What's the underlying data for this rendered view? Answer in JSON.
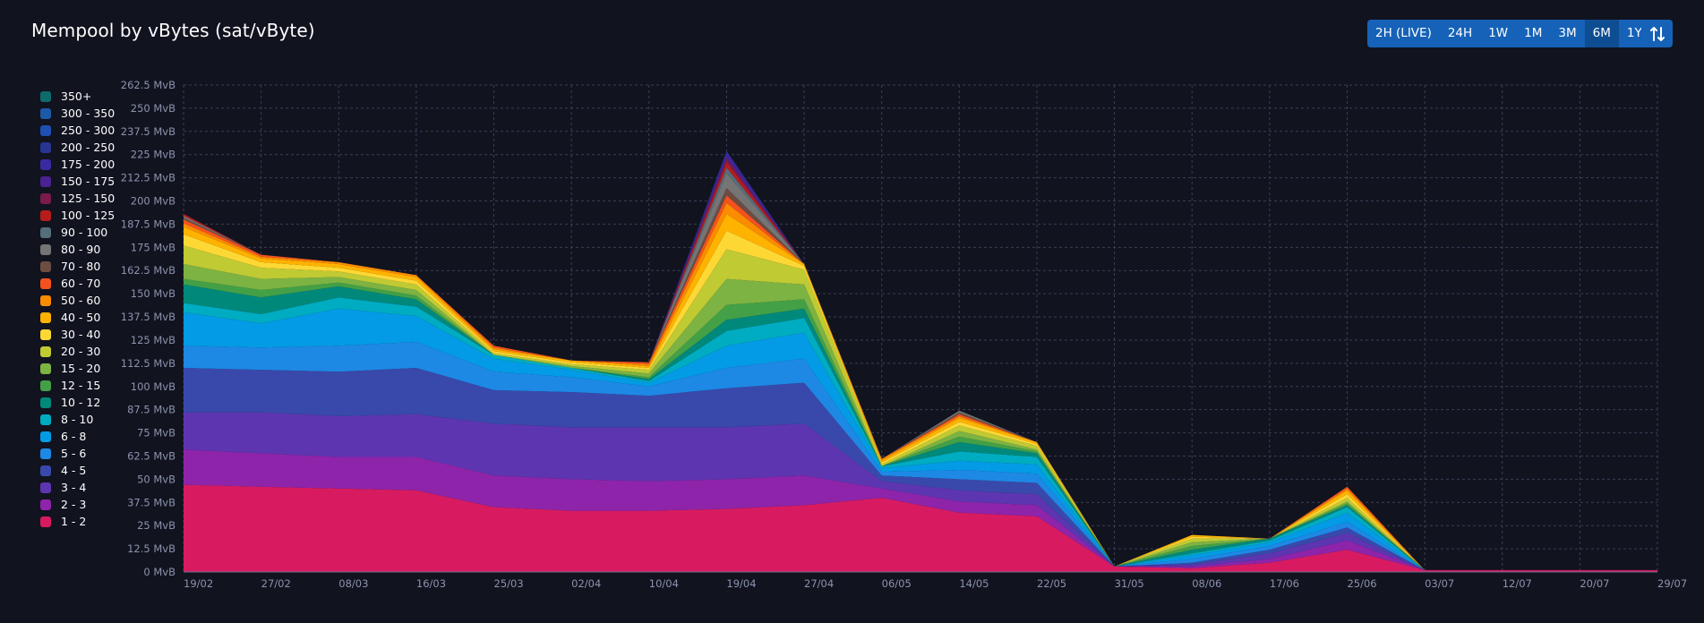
{
  "page": {
    "title": "Mempool by vBytes (sat/vByte)"
  },
  "range_buttons": [
    "2H (LIVE)",
    "24H",
    "1W",
    "1M",
    "3M",
    "6M",
    "1Y"
  ],
  "active_range": "6M",
  "invert_icon": "swap-vertical-icon",
  "chart_data": {
    "type": "area",
    "stacked": true,
    "title": "Mempool by vBytes (sat/vByte)",
    "ylabel_unit": "MvB",
    "ylim": [
      0,
      262.5
    ],
    "y_ticks": [
      "0 MvB",
      "12.5 MvB",
      "25 MvB",
      "37.5 MvB",
      "50 MvB",
      "62.5 MvB",
      "75 MvB",
      "87.5 MvB",
      "100 MvB",
      "112.5 MvB",
      "125 MvB",
      "137.5 MvB",
      "150 MvB",
      "162.5 MvB",
      "175 MvB",
      "187.5 MvB",
      "200 MvB",
      "212.5 MvB",
      "225 MvB",
      "237.5 MvB",
      "250 MvB",
      "262.5 MvB"
    ],
    "x_ticks": [
      "19/02",
      "27/02",
      "08/03",
      "16/03",
      "25/03",
      "02/04",
      "10/04",
      "19/04",
      "27/04",
      "06/05",
      "14/05",
      "22/05",
      "31/05",
      "08/06",
      "17/06",
      "25/06",
      "03/07",
      "12/07",
      "20/07",
      "29/07"
    ],
    "grid": true,
    "legend_position": "left",
    "legend": [
      {
        "label": "350+",
        "color": "#0e6b6b"
      },
      {
        "label": "300 - 350",
        "color": "#1b5aa6"
      },
      {
        "label": "250 - 300",
        "color": "#1e4fb3"
      },
      {
        "label": "200 - 250",
        "color": "#283593"
      },
      {
        "label": "175 - 200",
        "color": "#3a2aa0"
      },
      {
        "label": "150 - 175",
        "color": "#4a2292"
      },
      {
        "label": "125 - 150",
        "color": "#7b1b4d"
      },
      {
        "label": "100 - 125",
        "color": "#b71c1c"
      },
      {
        "label": "90 - 100",
        "color": "#546e7a"
      },
      {
        "label": "80 - 90",
        "color": "#757575"
      },
      {
        "label": "70 - 80",
        "color": "#6d4c41"
      },
      {
        "label": "60 - 70",
        "color": "#f4511e"
      },
      {
        "label": "50 - 60",
        "color": "#fb8c00"
      },
      {
        "label": "40 - 50",
        "color": "#ffb300"
      },
      {
        "label": "30 - 40",
        "color": "#fdd835"
      },
      {
        "label": "20 - 30",
        "color": "#c0ca33"
      },
      {
        "label": "15 - 20",
        "color": "#7cb342"
      },
      {
        "label": "12 - 15",
        "color": "#43a047"
      },
      {
        "label": "10 - 12",
        "color": "#00897b"
      },
      {
        "label": "8 - 10",
        "color": "#00acc1"
      },
      {
        "label": "6 - 8",
        "color": "#039be5"
      },
      {
        "label": "5 - 6",
        "color": "#1e88e5"
      },
      {
        "label": "4 - 5",
        "color": "#3949ab"
      },
      {
        "label": "3 - 4",
        "color": "#5e35b1"
      },
      {
        "label": "2 - 3",
        "color": "#8e24aa"
      },
      {
        "label": "1 - 2",
        "color": "#d81b60"
      }
    ],
    "x": [
      "19/02",
      "27/02",
      "08/03",
      "16/03",
      "25/03",
      "02/04",
      "10/04",
      "19/04",
      "27/04",
      "06/05",
      "14/05",
      "22/05",
      "31/05",
      "08/06",
      "17/06",
      "25/06",
      "03/07",
      "12/07",
      "20/07",
      "29/07"
    ],
    "series": [
      {
        "name": "1 - 2",
        "values": [
          47,
          46,
          45,
          44,
          35,
          33,
          33,
          34,
          36,
          40,
          32,
          30,
          3,
          2,
          5,
          12,
          1,
          1,
          1,
          1
        ]
      },
      {
        "name": "2 - 3",
        "values": [
          19,
          18,
          17,
          18,
          17,
          17,
          16,
          16,
          16,
          5,
          6,
          6,
          0,
          1,
          2,
          5,
          0,
          0,
          0,
          0
        ]
      },
      {
        "name": "3 - 4",
        "values": [
          20,
          22,
          22,
          23,
          28,
          28,
          29,
          28,
          28,
          4,
          6,
          6,
          0,
          1,
          3,
          4,
          0,
          0,
          0,
          0
        ]
      },
      {
        "name": "4 - 5",
        "values": [
          24,
          23,
          24,
          25,
          18,
          19,
          17,
          21,
          22,
          3,
          6,
          6,
          0,
          1,
          2,
          3,
          0,
          0,
          0,
          0
        ]
      },
      {
        "name": "5 - 6",
        "values": [
          12,
          12,
          14,
          14,
          10,
          8,
          5,
          11,
          13,
          2,
          5,
          5,
          0,
          2,
          2,
          3,
          0,
          0,
          0,
          0
        ]
      },
      {
        "name": "6 - 8",
        "values": [
          18,
          13,
          20,
          14,
          7,
          4,
          2,
          12,
          14,
          2,
          5,
          5,
          0,
          2,
          2,
          5,
          0,
          0,
          0,
          0
        ]
      },
      {
        "name": "8 - 10",
        "values": [
          5,
          5,
          6,
          5,
          2,
          1,
          1,
          8,
          8,
          1,
          5,
          4,
          0,
          1,
          1,
          3,
          0,
          0,
          0,
          0
        ]
      },
      {
        "name": "10 - 12",
        "values": [
          10,
          9,
          6,
          4,
          0,
          0,
          1,
          6,
          5,
          0,
          5,
          2,
          0,
          2,
          1,
          1,
          0,
          0,
          0,
          0
        ]
      },
      {
        "name": "12 - 15",
        "values": [
          3,
          4,
          2,
          2,
          0,
          0,
          1,
          8,
          5,
          0,
          3,
          1,
          0,
          2,
          0,
          1,
          0,
          0,
          0,
          0
        ]
      },
      {
        "name": "15 - 20",
        "values": [
          8,
          6,
          3,
          3,
          0,
          1,
          2,
          14,
          8,
          0,
          3,
          1,
          0,
          2,
          0,
          1,
          0,
          0,
          0,
          0
        ]
      },
      {
        "name": "20 - 30",
        "values": [
          10,
          6,
          3,
          3,
          1,
          1,
          2,
          16,
          8,
          1,
          3,
          2,
          0,
          2,
          0,
          2,
          0,
          0,
          0,
          0
        ]
      },
      {
        "name": "30 - 40",
        "values": [
          6,
          3,
          2,
          2,
          1,
          1,
          1,
          10,
          2,
          1,
          2,
          1,
          0,
          1,
          0,
          2,
          0,
          0,
          0,
          0
        ]
      },
      {
        "name": "40 - 50",
        "values": [
          4,
          2,
          2,
          2,
          1,
          1,
          1,
          9,
          1,
          1,
          2,
          1,
          0,
          1,
          0,
          2,
          0,
          0,
          0,
          0
        ]
      },
      {
        "name": "50 - 60",
        "values": [
          2,
          1,
          1,
          1,
          1,
          0,
          1,
          6,
          0,
          1,
          1,
          0,
          0,
          0,
          0,
          1,
          0,
          0,
          0,
          0
        ]
      },
      {
        "name": "60 - 70",
        "values": [
          2,
          1,
          0,
          0,
          1,
          0,
          1,
          4,
          0,
          0,
          1,
          0,
          0,
          0,
          0,
          1,
          0,
          0,
          0,
          0
        ]
      },
      {
        "name": "70 - 80",
        "values": [
          1,
          0,
          0,
          0,
          0,
          0,
          0,
          4,
          0,
          0,
          1,
          0,
          0,
          0,
          0,
          0,
          0,
          0,
          0,
          0
        ]
      },
      {
        "name": "80 - 90",
        "values": [
          1,
          0,
          0,
          0,
          0,
          0,
          0,
          8,
          0,
          0,
          1,
          0,
          0,
          0,
          0,
          0,
          0,
          0,
          0,
          0
        ]
      },
      {
        "name": "90 - 100",
        "values": [
          0,
          0,
          0,
          0,
          0,
          0,
          0,
          3,
          0,
          0,
          0,
          0,
          0,
          0,
          0,
          0,
          0,
          0,
          0,
          0
        ]
      },
      {
        "name": "100 - 125",
        "values": [
          1,
          0,
          0,
          0,
          0,
          0,
          0,
          3,
          0,
          0,
          0,
          0,
          0,
          0,
          0,
          0,
          0,
          0,
          0,
          0
        ]
      },
      {
        "name": "125 - 150",
        "values": [
          0,
          0,
          0,
          0,
          0,
          0,
          0,
          2,
          0,
          0,
          0,
          0,
          0,
          0,
          0,
          0,
          0,
          0,
          0,
          0
        ]
      },
      {
        "name": "150 - 175",
        "values": [
          0,
          0,
          0,
          0,
          0,
          0,
          0,
          2,
          0,
          0,
          0,
          0,
          0,
          0,
          0,
          0,
          0,
          0,
          0,
          0
        ]
      },
      {
        "name": "175 - 200",
        "values": [
          0,
          0,
          0,
          0,
          0,
          0,
          0,
          1,
          0,
          0,
          0,
          0,
          0,
          0,
          0,
          0,
          0,
          0,
          0,
          0
        ]
      },
      {
        "name": "200 - 250",
        "values": [
          0,
          0,
          0,
          0,
          0,
          0,
          0,
          1,
          0,
          0,
          0,
          0,
          0,
          0,
          0,
          0,
          0,
          0,
          0,
          0
        ]
      },
      {
        "name": "250 - 300",
        "values": [
          0,
          0,
          0,
          0,
          0,
          0,
          0,
          0,
          0,
          0,
          0,
          0,
          0,
          0,
          0,
          0,
          0,
          0,
          0,
          0
        ]
      },
      {
        "name": "300 - 350",
        "values": [
          0,
          0,
          0,
          0,
          0,
          0,
          0,
          0,
          0,
          0,
          0,
          0,
          0,
          0,
          0,
          0,
          0,
          0,
          0,
          0
        ]
      },
      {
        "name": "350+",
        "values": [
          0,
          0,
          0,
          0,
          0,
          0,
          0,
          0,
          0,
          0,
          0,
          0,
          0,
          0,
          0,
          0,
          0,
          0,
          0,
          0
        ]
      }
    ]
  }
}
